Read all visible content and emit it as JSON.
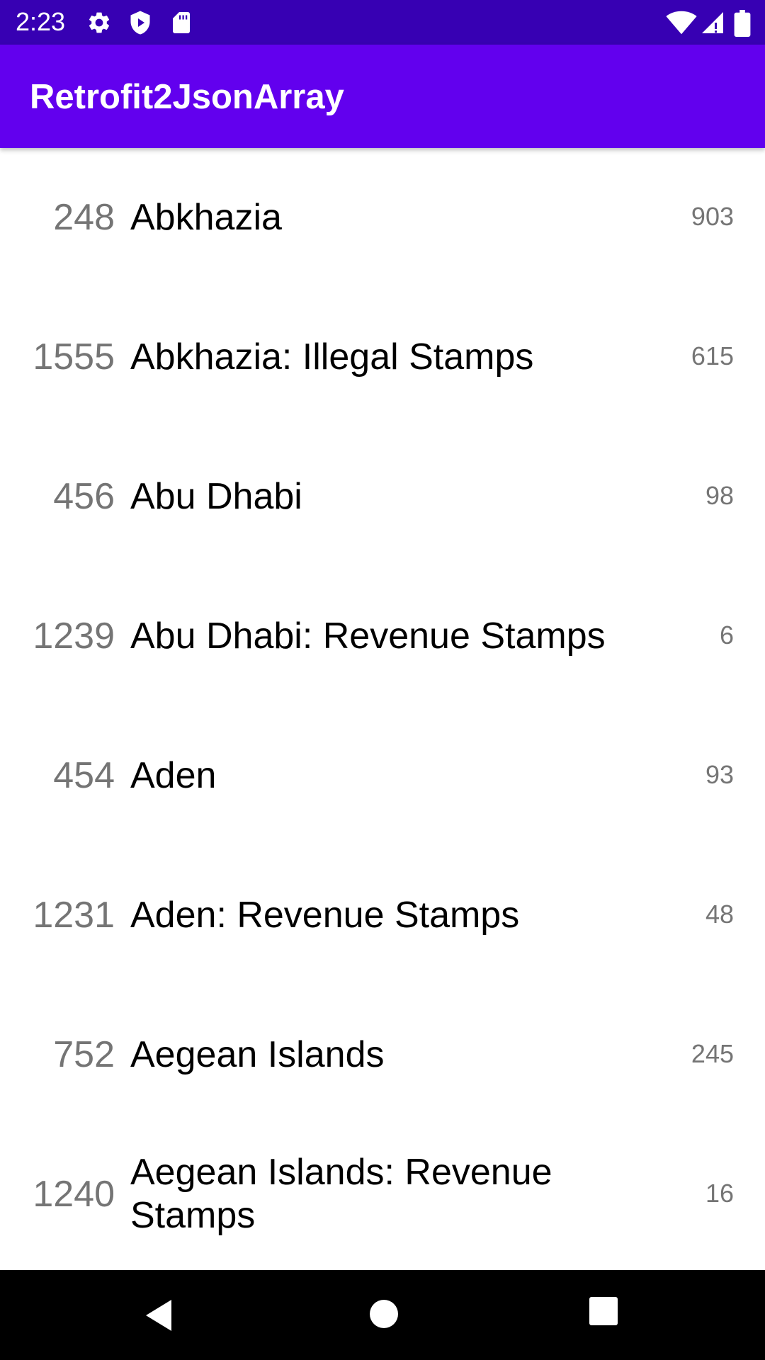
{
  "status_bar": {
    "time": "2:23",
    "icons": [
      "gear-icon",
      "shield-play-icon",
      "sd-card-icon",
      "wifi-icon",
      "signal-icon",
      "battery-icon"
    ]
  },
  "app_bar": {
    "title": "Retrofit2JsonArray",
    "color": "#6200ee"
  },
  "list": {
    "items": [
      {
        "id": "248",
        "name": "Abkhazia",
        "count": "903"
      },
      {
        "id": "1555",
        "name": "Abkhazia: Illegal Stamps",
        "count": "615"
      },
      {
        "id": "456",
        "name": "Abu Dhabi",
        "count": "98"
      },
      {
        "id": "1239",
        "name": "Abu Dhabi: Revenue Stamps",
        "count": "6"
      },
      {
        "id": "454",
        "name": "Aden",
        "count": "93"
      },
      {
        "id": "1231",
        "name": "Aden: Revenue Stamps",
        "count": "48"
      },
      {
        "id": "752",
        "name": "Aegean Islands",
        "count": "245"
      },
      {
        "id": "1240",
        "name": "Aegean Islands: Revenue Stamps",
        "count": "16"
      }
    ]
  },
  "nav_bar": {
    "buttons": [
      "back-icon",
      "home-icon",
      "recents-icon"
    ]
  }
}
